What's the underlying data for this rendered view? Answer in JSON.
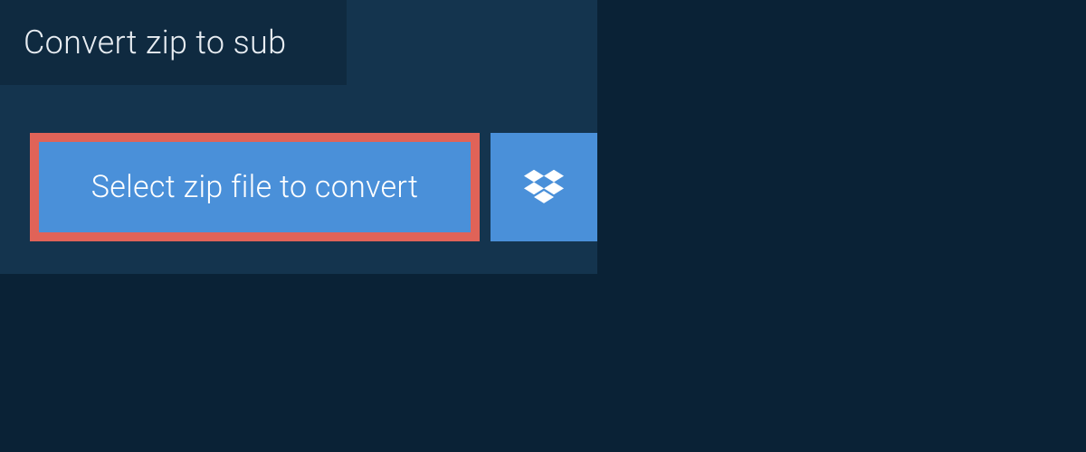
{
  "tab": {
    "label": "Convert zip to sub"
  },
  "select_button": {
    "label": "Select zip file to convert"
  },
  "colors": {
    "bg_dark": "#0a2236",
    "panel": "#14344e",
    "tab": "#0f2a40",
    "button_blue": "#4a90d9",
    "button_border_red": "#e06358",
    "text_light": "#e8edf2",
    "text_white": "#ffffff"
  }
}
